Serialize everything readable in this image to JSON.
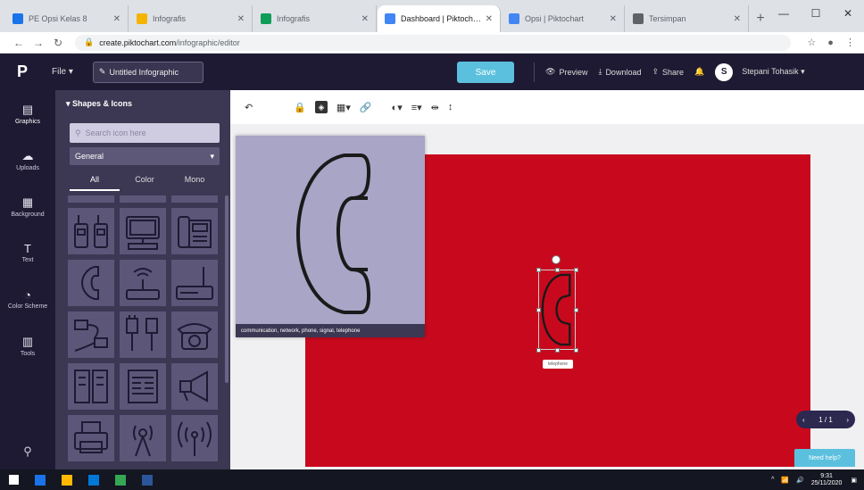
{
  "browser": {
    "tabs": [
      {
        "title": "PE Opsi Kelas 8",
        "color": "#1a73e8"
      },
      {
        "title": "Infografis",
        "color": "#f4b400"
      },
      {
        "title": "Infografis",
        "color": "#0f9d58"
      },
      {
        "title": "Dashboard | Piktochart",
        "color": "#4285f4"
      },
      {
        "title": "Opsi | Piktochart",
        "color": "#4285f4"
      },
      {
        "title": "Tersimpan",
        "color": "#5f6368"
      }
    ],
    "url_host": "create.piktochart.com",
    "url_path": "/infographic/editor"
  },
  "app": {
    "logo": "P",
    "file_menu": "File ▾",
    "doc_name": "Untitled Infographic",
    "save_label": "Save",
    "header_actions": [
      {
        "icon": "👁",
        "label": "Preview"
      },
      {
        "icon": "⤓",
        "label": "Download"
      },
      {
        "icon": "⇪",
        "label": "Share"
      }
    ],
    "avatar_letter": "S",
    "user_name": "Stepani Tohasik ▾"
  },
  "rail": [
    {
      "icon": "▤",
      "label": "Graphics"
    },
    {
      "icon": "☁",
      "label": "Uploads"
    },
    {
      "icon": "▦",
      "label": "Background"
    },
    {
      "icon": "T",
      "label": "Text"
    },
    {
      "icon": "◔",
      "label": "Color Scheme"
    },
    {
      "icon": "▥",
      "label": "Tools"
    }
  ],
  "rail_bottom_icon": "⚲",
  "panel": {
    "title": "▾ Shapes & Icons",
    "search_placeholder": "Search icon here",
    "select_value": "General",
    "filter_tabs": [
      "All",
      "Color",
      "Mono"
    ]
  },
  "preview_caption": "communication, network, phone, signal, telephone",
  "selection_tip": "telephone",
  "page_pill": {
    "prev": "‹",
    "label": "1 / 1",
    "next": "›"
  },
  "help_label": "Need help?",
  "taskbar": {
    "apps": [
      "#1a73e8",
      "#ffb900",
      "#0078d7",
      "#34a853",
      "#2b579a"
    ],
    "time": "9:31",
    "date": "25/11/2020"
  }
}
